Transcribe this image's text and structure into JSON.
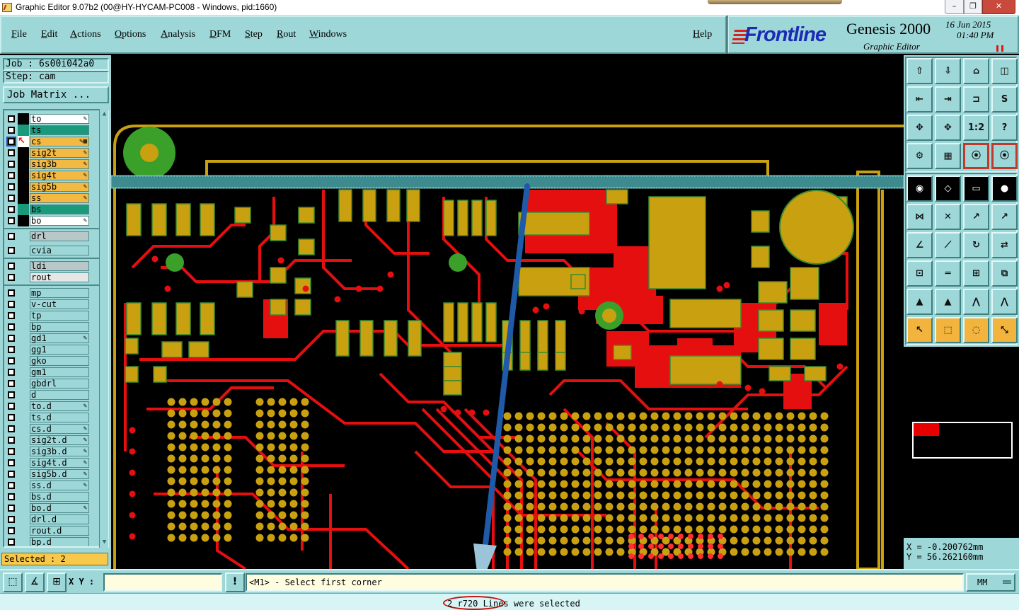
{
  "window": {
    "title": "Graphic Editor 9.07b2 (00@HY-HYCAM-PC008 - Windows, pid:1660)",
    "min_label": "–",
    "max_label": "❐",
    "close_label": "✕"
  },
  "menu": {
    "items": [
      "File",
      "Edit",
      "Actions",
      "Options",
      "Analysis",
      "DFM",
      "Step",
      "Rout",
      "Windows"
    ],
    "help": "Help"
  },
  "branding": {
    "logo": "Frontline",
    "product": "Genesis 2000",
    "subtitle": "Graphic Editor",
    "date": "16 Jun 2015",
    "time": "01:40 PM"
  },
  "job": {
    "job_label": "Job : 6s00i042a0",
    "step_label": "Step: cam",
    "matrix_button": "Job Matrix ..."
  },
  "layers": [
    {
      "name": "to",
      "color": "#ffffff",
      "mark": "black",
      "flag": "✎"
    },
    {
      "name": "ts",
      "color": "#1a9a7a",
      "mark": "green",
      "flag": ""
    },
    {
      "name": "cs",
      "color": "#f4b942",
      "mark": "red-work",
      "flag": "✎▦",
      "selected": true
    },
    {
      "name": "sig2t",
      "color": "#f4b942",
      "mark": "black",
      "flag": "✎"
    },
    {
      "name": "sig3b",
      "color": "#f4b942",
      "mark": "black",
      "flag": "✎"
    },
    {
      "name": "sig4t",
      "color": "#f4b942",
      "mark": "black",
      "flag": "✎"
    },
    {
      "name": "sig5b",
      "color": "#f4b942",
      "mark": "black",
      "flag": "✎"
    },
    {
      "name": "ss",
      "color": "#f4b942",
      "mark": "black",
      "flag": "✎"
    },
    {
      "name": "bs",
      "color": "#1a9a7a",
      "mark": "green",
      "flag": ""
    },
    {
      "name": "bo",
      "color": "#ffffff",
      "mark": "black",
      "flag": "✎"
    }
  ],
  "layers_drill": [
    {
      "name": "drl",
      "color": "#b8c8c8"
    },
    {
      "name": "cvia",
      "color": "#9ed7d8"
    }
  ],
  "layers_rout": [
    {
      "name": "ldi",
      "color": "#b8c8c8"
    },
    {
      "name": "rout",
      "color": "#e6e6e6"
    }
  ],
  "layers_misc": [
    {
      "name": "mp",
      "flag": ""
    },
    {
      "name": "v-cut",
      "flag": ""
    },
    {
      "name": "tp",
      "flag": ""
    },
    {
      "name": "bp",
      "flag": ""
    },
    {
      "name": "gd1",
      "flag": "✎"
    },
    {
      "name": "gg1",
      "flag": ""
    },
    {
      "name": "gko",
      "flag": ""
    },
    {
      "name": "gm1",
      "flag": ""
    },
    {
      "name": "gbdrl",
      "flag": ""
    },
    {
      "name": "d",
      "flag": ""
    },
    {
      "name": "to.d",
      "flag": "✎"
    },
    {
      "name": "ts.d",
      "flag": ""
    },
    {
      "name": "cs.d",
      "flag": "✎"
    },
    {
      "name": "sig2t.d",
      "flag": "✎"
    },
    {
      "name": "sig3b.d",
      "flag": "✎"
    },
    {
      "name": "sig4t.d",
      "flag": "✎"
    },
    {
      "name": "sig5b.d",
      "flag": "✎"
    },
    {
      "name": "ss.d",
      "flag": "✎"
    },
    {
      "name": "bs.d",
      "flag": ""
    },
    {
      "name": "bo.d",
      "flag": "✎"
    },
    {
      "name": "drl.d",
      "flag": ""
    },
    {
      "name": "rout.d",
      "flag": ""
    },
    {
      "name": "bp.d",
      "flag": ""
    }
  ],
  "selected_count": "Selected : 2",
  "toolbar": {
    "icons": [
      "zoom-home-icon",
      "zoom-back-icon",
      "home-view-icon",
      "split-window-icon",
      "pan-left-icon",
      "pan-right-icon",
      "mirror-icon",
      "redraw-icon",
      "fit-icon",
      "zoom-center-icon",
      "scale-1-2-icon",
      "query-icon",
      "settings-icon",
      "grid-icon",
      "traffic-light-icon",
      "traffic-light-alt-icon",
      "snap-icon",
      "draw-line-icon",
      "measure-icon",
      "pad-icon",
      "connect-icon",
      "cross-icon",
      "arrow-icon",
      "arrow-alt-icon",
      "angle-icon",
      "line-icon",
      "rotate-icon",
      "flip-icon",
      "move-icon",
      "bar-icon",
      "box-icon",
      "group-icon",
      "triangle-icon",
      "triangle-arrow-icon",
      "arch-icon",
      "arch-cross-icon",
      "pointer-icon",
      "select-box-icon",
      "select-circle-icon",
      "select-net-icon"
    ],
    "icon_glyphs": [
      "⇧",
      "⇩",
      "⌂",
      "◫",
      "⇤",
      "⇥",
      "⊐",
      "S",
      "✥",
      "✥",
      "1:2",
      "?",
      "⚙",
      "▦",
      "⦿",
      "⦿",
      "◉",
      "◇",
      "▭",
      "●",
      "⋈",
      "✕",
      "↗",
      "↗",
      "∠",
      "⟋",
      "↻",
      "⇄",
      "⊡",
      "═",
      "⊞",
      "⧉",
      "▲",
      "▲",
      "⋀",
      "⋀",
      "↖",
      "⬚",
      "◌",
      "⤡"
    ]
  },
  "coords": {
    "x": "X =  -0.200762mm",
    "y": "Y =  56.262160mm"
  },
  "bottom": {
    "xy_label": "X Y :",
    "xy_value": "",
    "alert_label": "!",
    "prompt": "<M1> - Select first corner",
    "units": "MM"
  },
  "status": {
    "message": "2 r720 Lines were selected"
  },
  "colors": {
    "panel": "#9ed7d8",
    "copper": "#e60f0f",
    "pad": "#c9a010",
    "pad_outline": "#3a8a30",
    "via": "#3aa02a",
    "highlight": "#1e5aa8"
  }
}
